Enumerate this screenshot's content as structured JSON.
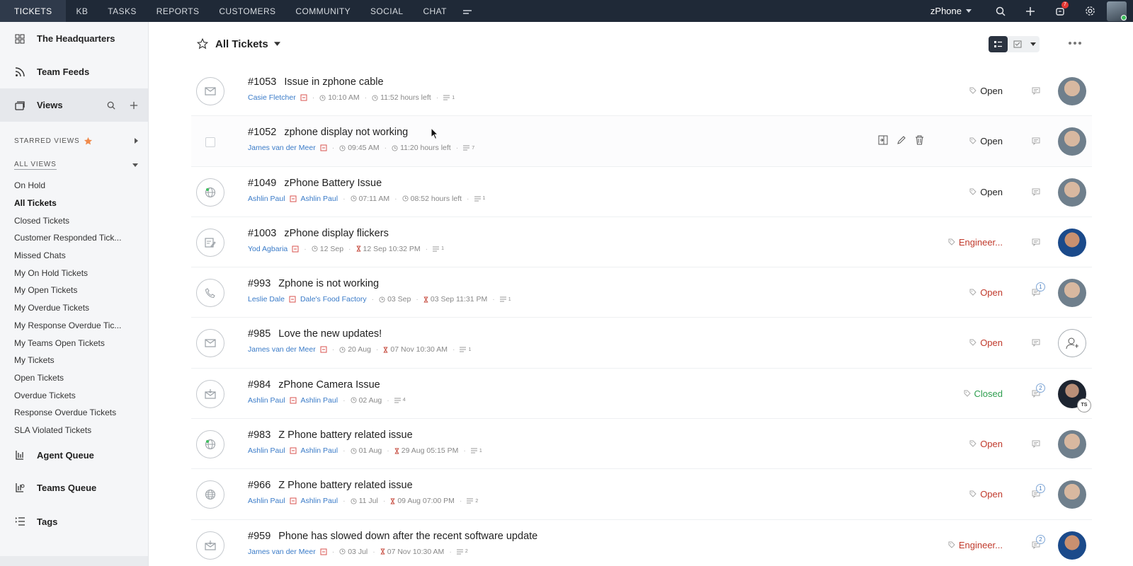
{
  "topbar": {
    "tabs": [
      "TICKETS",
      "KB",
      "TASKS",
      "REPORTS",
      "CUSTOMERS",
      "COMMUNITY",
      "SOCIAL",
      "CHAT"
    ],
    "active_tab": "TICKETS",
    "brand": "zPhone",
    "notification_count": "7"
  },
  "sidebar": {
    "headquarters": "The Headquarters",
    "team_feeds": "Team Feeds",
    "views": "Views",
    "starred_views": "STARRED VIEWS",
    "all_views": "ALL VIEWS",
    "view_items": [
      "On Hold",
      "All Tickets",
      "Closed Tickets",
      "Customer Responded Tick...",
      "Missed Chats",
      "My On Hold Tickets",
      "My Open Tickets",
      "My Overdue Tickets",
      "My Response Overdue Tic...",
      "My Teams Open Tickets",
      "My Tickets",
      "Open Tickets",
      "Overdue Tickets",
      "Response Overdue Tickets",
      "SLA Violated Tickets"
    ],
    "current_view": "All Tickets",
    "agent_queue": "Agent Queue",
    "teams_queue": "Teams Queue",
    "tags": "Tags"
  },
  "header": {
    "title": "All Tickets"
  },
  "tickets": [
    {
      "num": "#1053",
      "subject": "Issue in zphone cable",
      "contact": "Casie Fletcher",
      "account": "",
      "created": "10:10 AM",
      "due": "11:52 hours left",
      "threads": "1",
      "status": "Open",
      "status_style": "dark",
      "comments": "",
      "owner": "a",
      "channel": "email"
    },
    {
      "num": "#1052",
      "subject": "zphone display not working",
      "contact": "James van der Meer",
      "account": "",
      "created": "09:45 AM",
      "due": "11:20 hours left",
      "threads": "7",
      "status": "Open",
      "status_style": "dark",
      "comments": "",
      "owner": "a",
      "channel": "checkbox"
    },
    {
      "num": "#1049",
      "subject": "zPhone Battery Issue",
      "contact": "Ashlin Paul",
      "account": "Ashlin Paul",
      "created": "07:11 AM",
      "due": "08:52 hours left",
      "threads": "1",
      "status": "Open",
      "status_style": "dark",
      "comments": "",
      "owner": "a",
      "channel": "web"
    },
    {
      "num": "#1003",
      "subject": "zPhone display flickers",
      "contact": "Yod Agbaria",
      "account": "",
      "created": "12 Sep",
      "due": "12 Sep 10:32 PM",
      "threads": "1",
      "status": "Engineer...",
      "status_style": "eng",
      "comments": "",
      "owner": "b",
      "channel": "form"
    },
    {
      "num": "#993",
      "subject": "Zphone is not working",
      "contact": "Leslie Dale",
      "account": "Dale's Food Factory",
      "created": "03 Sep",
      "due": "03 Sep 11:31 PM",
      "threads": "1",
      "status": "Open",
      "status_style": "red",
      "comments": "1",
      "owner": "a",
      "channel": "phone"
    },
    {
      "num": "#985",
      "subject": "Love the new updates!",
      "contact": "James van der Meer",
      "account": "",
      "created": "20 Aug",
      "due": "07 Nov 10:30 AM",
      "threads": "1",
      "status": "Open",
      "status_style": "red",
      "comments": "",
      "owner": "empty",
      "channel": "email"
    },
    {
      "num": "#984",
      "subject": "zPhone Camera Issue",
      "contact": "Ashlin Paul",
      "account": "Ashlin Paul",
      "created": "02 Aug",
      "due": "",
      "threads": "4",
      "status": "Closed",
      "status_style": "green",
      "comments": "2",
      "owner": "c",
      "channel": "email-in"
    },
    {
      "num": "#983",
      "subject": "Z Phone battery related issue",
      "contact": "Ashlin Paul",
      "account": "Ashlin Paul",
      "created": "01 Aug",
      "due": "29 Aug 05:15 PM",
      "threads": "1",
      "status": "Open",
      "status_style": "red",
      "comments": "",
      "owner": "a",
      "channel": "web"
    },
    {
      "num": "#966",
      "subject": "Z Phone battery related issue",
      "contact": "Ashlin Paul",
      "account": "Ashlin Paul",
      "created": "11 Jul",
      "due": "09 Aug 07:00 PM",
      "threads": "2",
      "status": "Open",
      "status_style": "red",
      "comments": "1",
      "owner": "a",
      "channel": "web2"
    },
    {
      "num": "#959",
      "subject": "Phone has slowed down after the recent software update",
      "contact": "James van der Meer",
      "account": "",
      "created": "03 Jul",
      "due": "07 Nov 10:30 AM",
      "threads": "2",
      "status": "Engineer...",
      "status_style": "eng",
      "comments": "2",
      "owner": "b",
      "channel": "email-in"
    }
  ],
  "owner_initials": "TS",
  "colors": {
    "topbar": "#1f2937",
    "link": "#3a7bc8",
    "red": "#c0392b",
    "green": "#2e9e4f",
    "star": "#f08a4b"
  }
}
